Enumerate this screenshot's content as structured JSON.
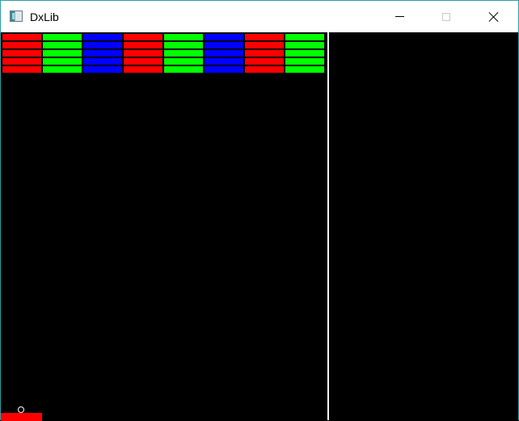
{
  "window": {
    "title": "DxLib",
    "icon": "app-window-icon",
    "controls": [
      "minimize-icon",
      "maximize-icon",
      "close-icon"
    ]
  },
  "game": {
    "type": "breakout",
    "background_color": "#000000",
    "divider_color": "#ffffff",
    "bricks": {
      "rows": 5,
      "columns": 8,
      "column_colors": [
        "#ff0000",
        "#00ff00",
        "#0000ff",
        "#ff0000",
        "#00ff00",
        "#0000ff",
        "#ff0000",
        "#00ff00"
      ]
    },
    "paddle": {
      "color": "#ff0000"
    },
    "ball": {
      "color": "#ffffff"
    }
  }
}
